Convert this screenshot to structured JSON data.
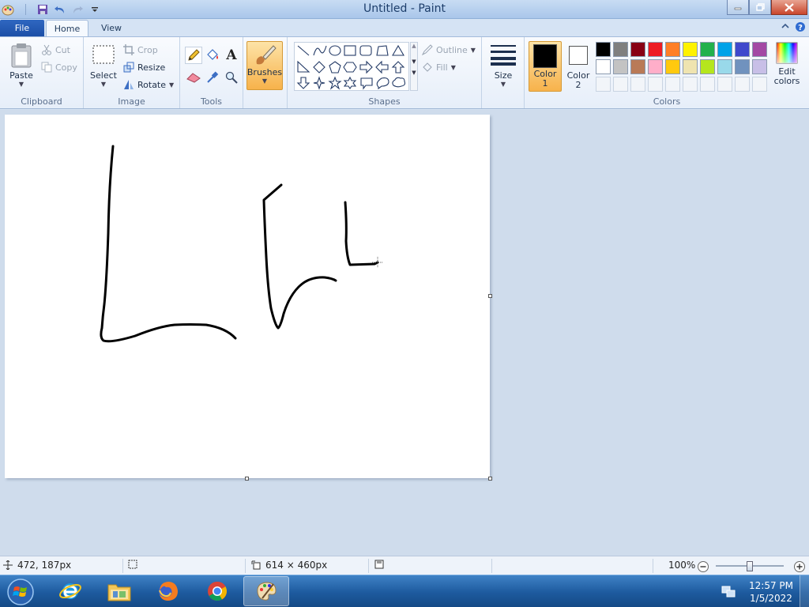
{
  "window": {
    "title": "Untitled - Paint"
  },
  "tabs": {
    "file": "File",
    "home": "Home",
    "view": "View"
  },
  "ribbon": {
    "clipboard": {
      "label": "Clipboard",
      "paste": "Paste",
      "cut": "Cut",
      "copy": "Copy"
    },
    "image": {
      "label": "Image",
      "select": "Select",
      "crop": "Crop",
      "resize": "Resize",
      "rotate": "Rotate"
    },
    "tools": {
      "label": "Tools"
    },
    "brushes": {
      "label": "Brushes"
    },
    "shapes": {
      "label": "Shapes",
      "outline": "Outline",
      "fill": "Fill",
      "items": [
        "line",
        "curve",
        "oval",
        "rectangle",
        "rounded-rectangle",
        "polygon",
        "triangle",
        "right-triangle",
        "diamond",
        "pentagon",
        "hexagon",
        "right-arrow",
        "left-arrow",
        "up-arrow",
        "down-arrow",
        "four-point-star",
        "five-point-star",
        "six-point-star",
        "rounded-callout",
        "oval-callout",
        "cloud-callout"
      ]
    },
    "size": {
      "label": "Size"
    },
    "colors": {
      "label": "Colors",
      "color1_label": "Color",
      "color1_num": "1",
      "color2_label": "Color",
      "color2_num": "2",
      "color1": "#000000",
      "color2": "#ffffff",
      "edit": "Edit colors",
      "palette_row1": [
        "#000000",
        "#7f7f7f",
        "#880015",
        "#ed1c24",
        "#ff7f27",
        "#fff200",
        "#22b14c",
        "#00a2e8",
        "#3f48cc",
        "#a349a4"
      ],
      "palette_row2": [
        "#ffffff",
        "#c3c3c3",
        "#b97a57",
        "#ffaec9",
        "#ffc90e",
        "#efe4b0",
        "#b5e61d",
        "#99d9ea",
        "#7092be",
        "#c8bfe7"
      ]
    }
  },
  "status": {
    "cursor_pos": "472, 187px",
    "canvas_size": "614 × 460px",
    "zoom": "100%",
    "zoom_fraction": 0.5
  },
  "taskbar": {
    "time": "12:57 PM",
    "date": "1/5/2022",
    "apps": [
      "internet-explorer",
      "file-explorer",
      "firefox",
      "chrome",
      "paint"
    ]
  }
}
